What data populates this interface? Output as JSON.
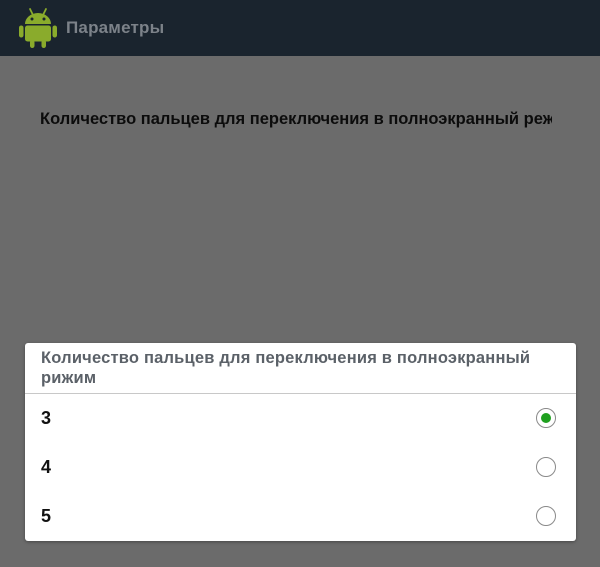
{
  "action_bar": {
    "icon": "android-icon",
    "title": "Параметры"
  },
  "preference": {
    "title": "Количество пальцев для переключения в полноэкранный режим"
  },
  "dialog": {
    "title": "Количество пальцев для переключения в полноэкранный  рижим",
    "options": [
      {
        "label": "3",
        "selected": true
      },
      {
        "label": "4",
        "selected": false
      },
      {
        "label": "5",
        "selected": false
      }
    ],
    "accent_color": "#1fa01f"
  }
}
